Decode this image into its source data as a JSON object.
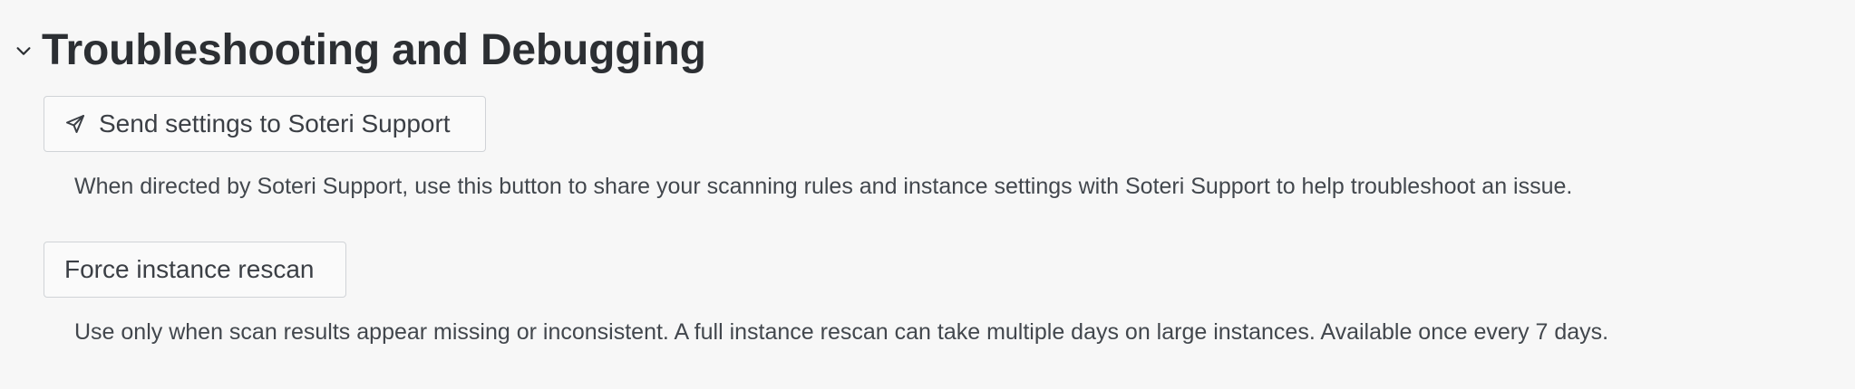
{
  "section": {
    "title": "Troubleshooting and Debugging",
    "expanded": true,
    "chevron_icon": "chevron-down-icon"
  },
  "actions": {
    "send_settings": {
      "label": "Send settings to Soteri Support",
      "icon": "send-paper-plane-icon",
      "description": "When directed by Soteri Support, use this button to share your scanning rules and instance settings with Soteri Support to help troubleshoot an issue."
    },
    "force_rescan": {
      "label": "Force instance rescan",
      "description": "Use only when scan results appear missing or inconsistent. A full instance rescan can take multiple days on large instances. Available once every 7 days."
    }
  },
  "colors": {
    "background": "#f7f7f7",
    "title_text": "#2c2f33",
    "body_text": "#42474d",
    "button_border": "#d0d3d7"
  }
}
